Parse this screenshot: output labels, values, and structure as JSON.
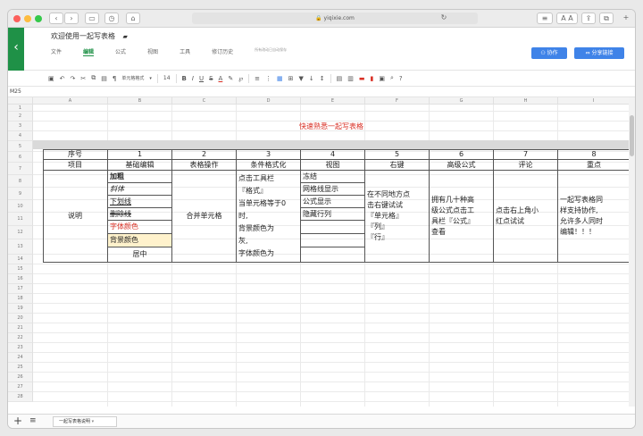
{
  "browser": {
    "url": "yiqixie.com",
    "colors": {
      "close": "#fc605c",
      "minimize": "#fdbc40",
      "zoom": "#34c84a"
    }
  },
  "app": {
    "title": "欢迎使用一起写表格",
    "menu": [
      "文件",
      "编辑",
      "公式",
      "视图",
      "工具",
      "修订历史"
    ],
    "autosave": "所有改动已自动保存",
    "collab_button": "协作",
    "share_button": "分享链接",
    "accent": "#1f9147",
    "button_color": "#3f83e8"
  },
  "toolbar": {
    "cell_format": "单元格格式",
    "font_size": "14",
    "bold": "B",
    "italic": "I",
    "underline": "U",
    "strike": "S",
    "font_color": "A"
  },
  "cell_ref": "M25",
  "columns": [
    "A",
    "B",
    "C",
    "D",
    "E",
    "F",
    "G",
    "H",
    "I"
  ],
  "row_numbers": [
    "1",
    "2",
    "3",
    "4",
    "5",
    "6",
    "7",
    "8",
    "9",
    "10",
    "11",
    "12",
    "13",
    "14",
    "15",
    "16",
    "17",
    "18",
    "19",
    "20",
    "21",
    "22",
    "23",
    "24",
    "25",
    "26",
    "27",
    "28"
  ],
  "sheet": {
    "title": "快速熟悉一起写表格",
    "title_color": "#d93025",
    "numbers": [
      "序号",
      "1",
      "2",
      "3",
      "4",
      "5",
      "6",
      "7",
      "8"
    ],
    "items": [
      "项目",
      "基础编辑",
      "表格操作",
      "条件格式化",
      "视图",
      "右键",
      "高级公式",
      "评论",
      "重点"
    ],
    "label": "说明",
    "basic_edit": [
      "加粗",
      "斜体",
      "下划线",
      "删除线",
      "字体颜色",
      "背景颜色",
      "居中"
    ],
    "merge": "合并单元格",
    "cond_format": [
      "点击工具栏",
      "『格式』",
      "当单元格等于0",
      "时,",
      "背景颜色为",
      "灰,",
      "字体颜色为"
    ],
    "view": [
      "冻结",
      "网格线显示",
      "公式显示",
      "隐藏行列"
    ],
    "right_click": [
      "在不同地方点",
      "击右键试试",
      "『单元格』",
      "『列』",
      "『行』"
    ],
    "advanced": [
      "拥有几十种高",
      "级公式点击工",
      "具栏『公式』",
      "查看"
    ],
    "comment": [
      "点击右上角小",
      "红点试试"
    ],
    "key_point": [
      "一起写表格同",
      "样支持协作,",
      "允许多人同时",
      "编辑！！！"
    ],
    "font_color_red": "#d93025",
    "highlight_bg": "#fff2cc",
    "band_color": "#d9d9d9"
  },
  "sheet_tab": "一起写表格说明"
}
